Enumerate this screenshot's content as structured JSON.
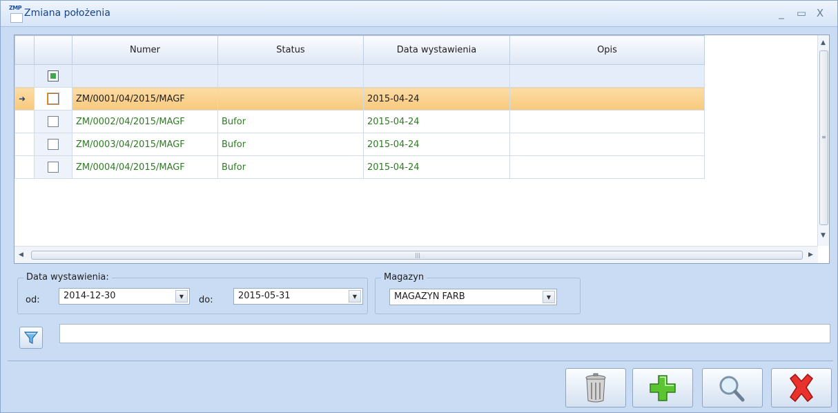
{
  "window": {
    "icon_tag": "ZMP",
    "title": "Zmiana położenia",
    "controls": {
      "minimize": "_",
      "maximize": "▭",
      "close": "X"
    }
  },
  "grid": {
    "columns": [
      "Numer",
      "Status",
      "Data wystawienia",
      "Opis"
    ],
    "rows": [
      {
        "numer": "ZM/0001/04/2015/MAGF",
        "status": "",
        "data": "2015-04-24",
        "opis": "",
        "selected": true
      },
      {
        "numer": "ZM/0002/04/2015/MAGF",
        "status": "Bufor",
        "data": "2015-04-24",
        "opis": ""
      },
      {
        "numer": "ZM/0003/04/2015/MAGF",
        "status": "Bufor",
        "data": "2015-04-24",
        "opis": ""
      },
      {
        "numer": "ZM/0004/04/2015/MAGF",
        "status": "Bufor",
        "data": "2015-04-24",
        "opis": ""
      }
    ],
    "current_row_icon": "row-pointer-icon"
  },
  "filters": {
    "date_group": {
      "legend": "Data wystawienia:",
      "from_label": "od:",
      "from_value": "2014-12-30",
      "to_label": "do:",
      "to_value": "2015-05-31"
    },
    "warehouse_group": {
      "legend": "Magazyn",
      "value": "MAGAZYN FARB"
    },
    "search_value": ""
  },
  "actions": {
    "filter_icon": "funnel-icon",
    "delete_icon": "trash-icon",
    "add_icon": "plus-icon",
    "open_icon": "magnifier-icon",
    "close_icon": "red-x-icon"
  },
  "colors": {
    "selected_row": "#f8c97c",
    "status_text": "#2f7a25",
    "frame_bg": "#c9dcf3"
  }
}
